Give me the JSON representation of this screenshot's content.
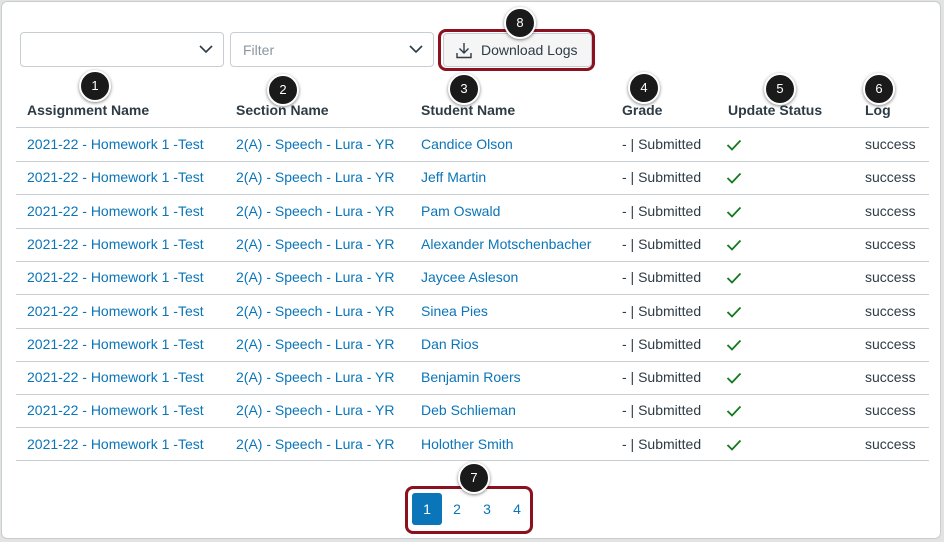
{
  "toolbar": {
    "select1_value": "",
    "filter_placeholder": "Filter",
    "download_label": "Download Logs"
  },
  "columns": [
    "Assignment Name",
    "Section Name",
    "Student Name",
    "Grade",
    "Update Status",
    "Log"
  ],
  "rows": [
    {
      "assignment": "2021-22 - Homework 1 -Test",
      "section": "2(A) - Speech - Lura - YR",
      "student": "Candice Olson",
      "grade": "- | Submitted",
      "status": "check-icon",
      "log": "success"
    },
    {
      "assignment": "2021-22 - Homework 1 -Test",
      "section": "2(A) - Speech - Lura - YR",
      "student": "Jeff Martin",
      "grade": "- | Submitted",
      "status": "check-icon",
      "log": "success"
    },
    {
      "assignment": "2021-22 - Homework 1 -Test",
      "section": "2(A) - Speech - Lura - YR",
      "student": "Pam Oswald",
      "grade": "- | Submitted",
      "status": "check-icon",
      "log": "success"
    },
    {
      "assignment": "2021-22 - Homework 1 -Test",
      "section": "2(A) - Speech - Lura - YR",
      "student": "Alexander Motschenbacher",
      "grade": "- | Submitted",
      "status": "check-icon",
      "log": "success"
    },
    {
      "assignment": "2021-22 - Homework 1 -Test",
      "section": "2(A) - Speech - Lura - YR",
      "student": "Jaycee Asleson",
      "grade": "- | Submitted",
      "status": "check-icon",
      "log": "success"
    },
    {
      "assignment": "2021-22 - Homework 1 -Test",
      "section": "2(A) - Speech - Lura - YR",
      "student": "Sinea Pies",
      "grade": "- | Submitted",
      "status": "check-icon",
      "log": "success"
    },
    {
      "assignment": "2021-22 - Homework 1 -Test",
      "section": "2(A) - Speech - Lura - YR",
      "student": "Dan Rios",
      "grade": "- | Submitted",
      "status": "check-icon",
      "log": "success"
    },
    {
      "assignment": "2021-22 - Homework 1 -Test",
      "section": "2(A) - Speech - Lura - YR",
      "student": "Benjamin Roers",
      "grade": "- | Submitted",
      "status": "check-icon",
      "log": "success"
    },
    {
      "assignment": "2021-22 - Homework 1 -Test",
      "section": "2(A) - Speech - Lura - YR",
      "student": "Deb Schlieman",
      "grade": "- | Submitted",
      "status": "check-icon",
      "log": "success"
    },
    {
      "assignment": "2021-22 - Homework 1 -Test",
      "section": "2(A) - Speech - Lura - YR",
      "student": "Holother Smith",
      "grade": "- | Submitted",
      "status": "check-icon",
      "log": "success"
    }
  ],
  "pagination": {
    "pages": [
      "1",
      "2",
      "3",
      "4"
    ],
    "current": "1"
  },
  "callouts": [
    "1",
    "2",
    "3",
    "4",
    "5",
    "6",
    "7",
    "8"
  ],
  "colors": {
    "accent": "#0a75b8",
    "callout_border": "#8b1120",
    "success_check": "#127a1b",
    "text": "#2d3b45",
    "border": "#c7cdd1"
  }
}
